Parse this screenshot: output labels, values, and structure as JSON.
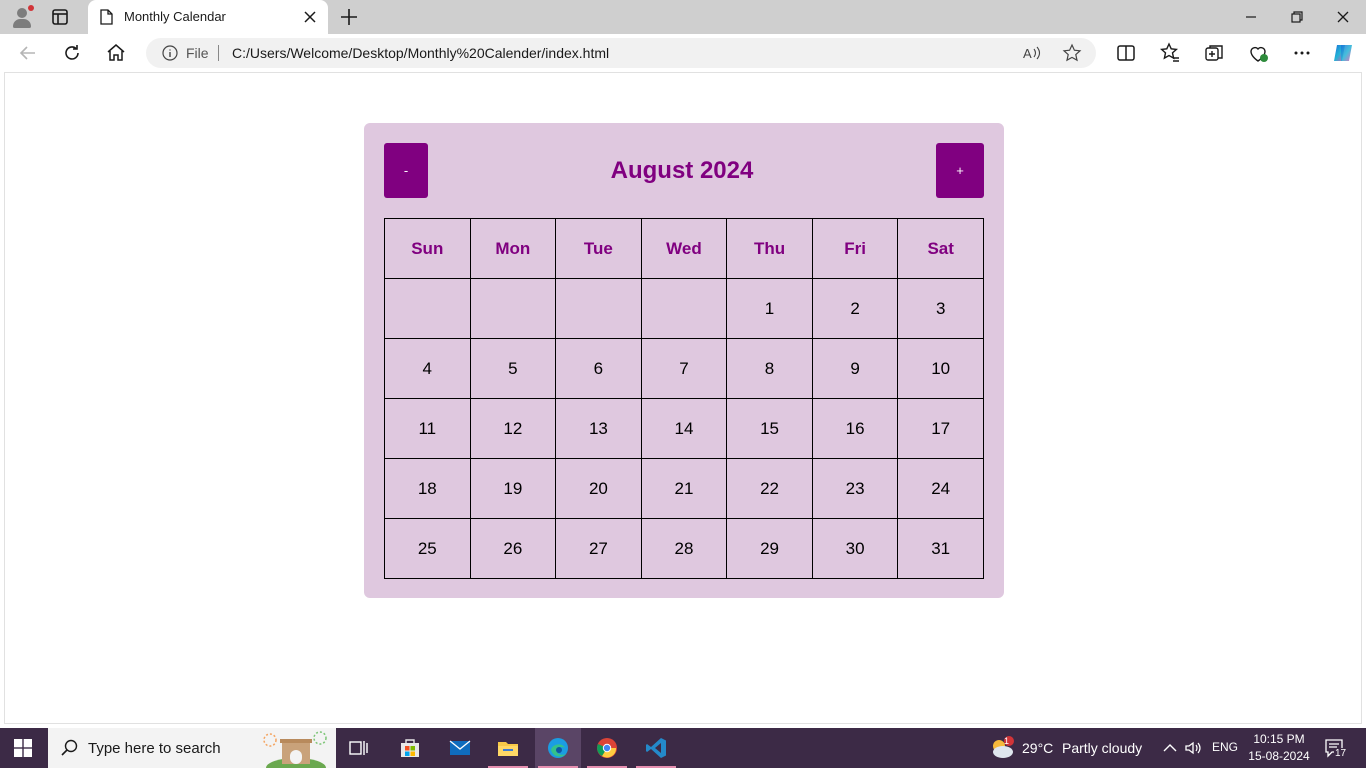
{
  "browser": {
    "tab_title": "Monthly Calendar",
    "address": {
      "scheme_label": "File",
      "url": "C:/Users/Welcome/Desktop/Monthly%20Calender/index.html"
    }
  },
  "calendar": {
    "title": "August 2024",
    "prev_label": "-",
    "next_label": "+",
    "weekdays": [
      "Sun",
      "Mon",
      "Tue",
      "Wed",
      "Thu",
      "Fri",
      "Sat"
    ],
    "weeks": [
      [
        "",
        "",
        "",
        "",
        "1",
        "2",
        "3"
      ],
      [
        "4",
        "5",
        "6",
        "7",
        "8",
        "9",
        "10"
      ],
      [
        "11",
        "12",
        "13",
        "14",
        "15",
        "16",
        "17"
      ],
      [
        "18",
        "19",
        "20",
        "21",
        "22",
        "23",
        "24"
      ],
      [
        "25",
        "26",
        "27",
        "28",
        "29",
        "30",
        "31"
      ]
    ],
    "colors": {
      "accent": "#800080",
      "panel": "#dfc8df",
      "cell_text": "#000000"
    }
  },
  "taskbar": {
    "search_placeholder": "Type here to search",
    "weather": {
      "temp": "29°C",
      "condition": "Partly cloudy",
      "badge": "1"
    },
    "language": "ENG",
    "time": "10:15 PM",
    "date": "15-08-2024",
    "notifications": "17",
    "apps": [
      "task-view",
      "microsoft-store",
      "mail",
      "file-explorer",
      "edge",
      "chrome",
      "vscode"
    ],
    "colors": {
      "background": "#3c2a46"
    }
  }
}
